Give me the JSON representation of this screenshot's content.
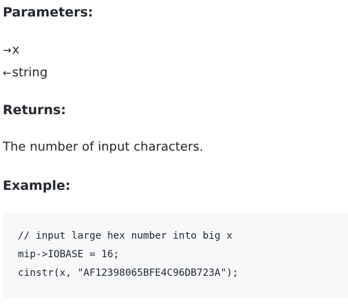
{
  "parameters": {
    "heading": "Parameters:",
    "input": {
      "arrow": "→",
      "name": "x"
    },
    "output": {
      "arrow": "←",
      "name": "string"
    }
  },
  "returns": {
    "heading": "Returns:",
    "text": "The number of input characters."
  },
  "example": {
    "heading": "Example:",
    "code_lines": [
      "// input large hex number into big x",
      "mip->IOBASE = 16;",
      "cinstr(x, \"AF12398065BFE4C96DB723A\");"
    ]
  }
}
